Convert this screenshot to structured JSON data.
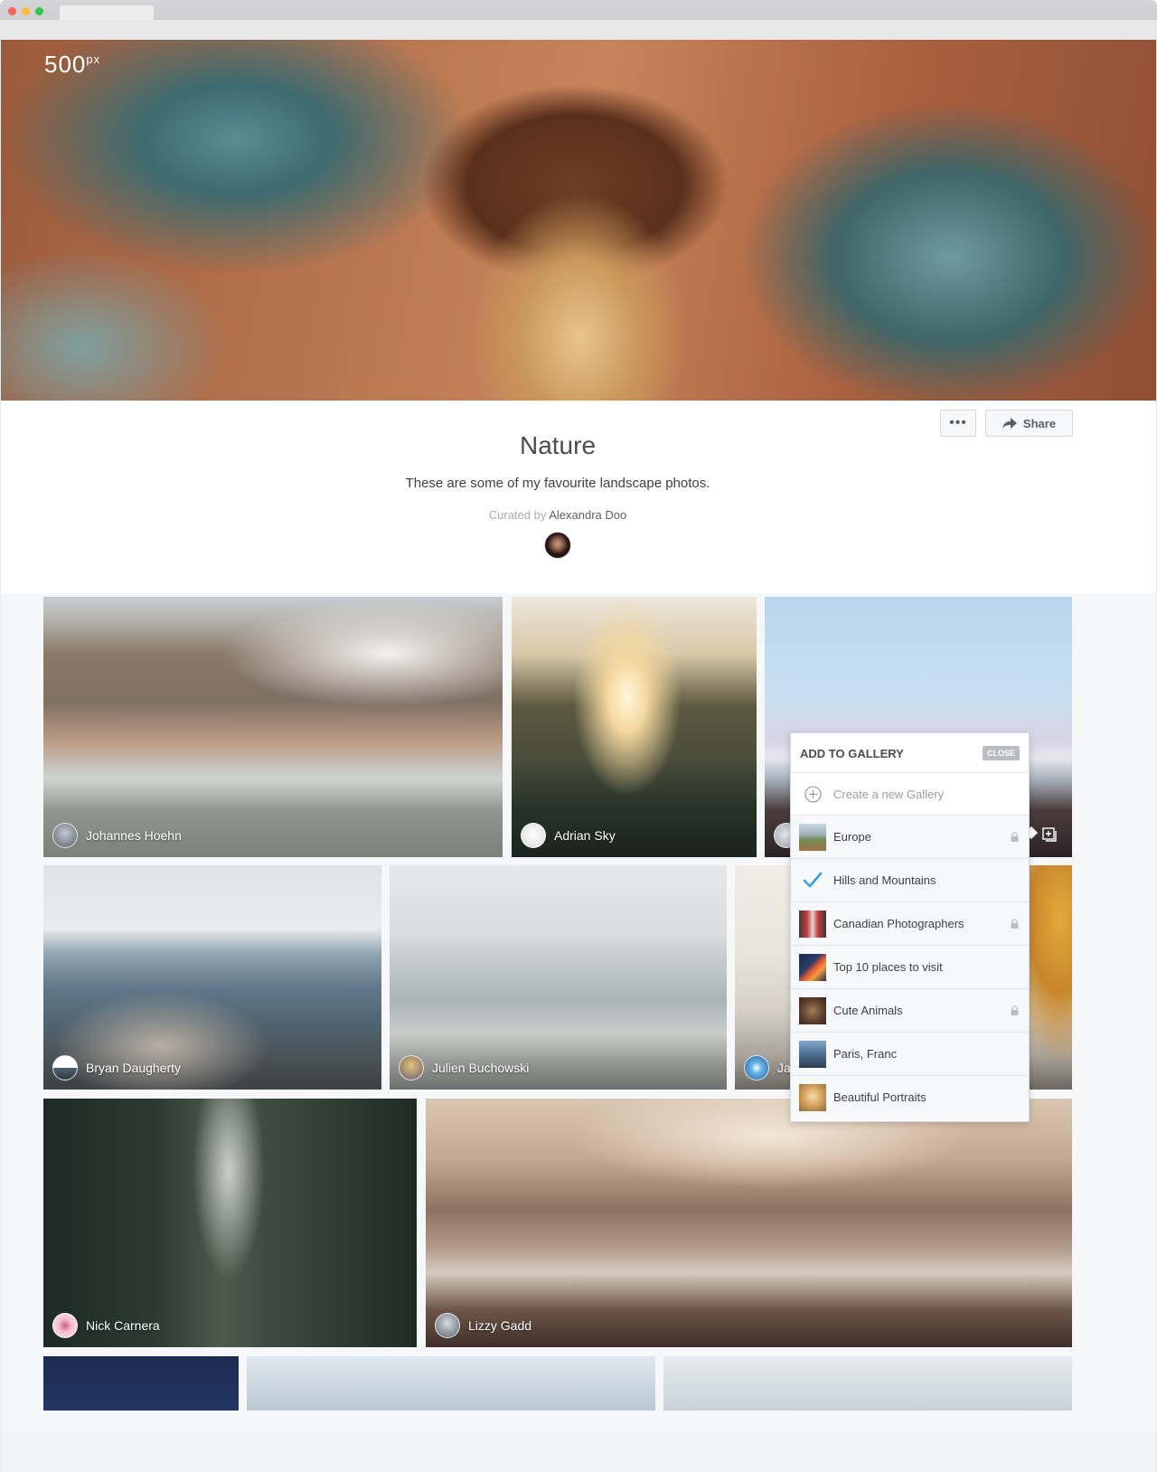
{
  "brand": {
    "logo_text": "500",
    "logo_sup": "px"
  },
  "gallery": {
    "title": "Nature",
    "description": "These are some of my favourite landscape photos.",
    "curated_prefix": "Curated by",
    "curator": "Alexandra Doo"
  },
  "actions": {
    "more": "•••",
    "share": "Share"
  },
  "photos": [
    {
      "author": "Johannes Hoehn"
    },
    {
      "author": "Adrian Sky"
    },
    {
      "author": ""
    },
    {
      "author": "Bryan Daugherty"
    },
    {
      "author": "Julien Buchowski"
    },
    {
      "author": "Ja"
    },
    {
      "author": "Nick Carnera"
    },
    {
      "author": "Lizzy Gadd"
    }
  ],
  "add_to_gallery": {
    "title": "ADD TO GALLERY",
    "close": "CLOSE",
    "create_label": "Create a new Gallery",
    "items": [
      {
        "name": "Europe",
        "locked": true,
        "checked": false,
        "thumb": "thumb-europe"
      },
      {
        "name": "Hills and Mountains",
        "locked": false,
        "checked": true,
        "thumb": "check-icon"
      },
      {
        "name": "Canadian Photographers",
        "locked": true,
        "checked": false,
        "thumb": "thumb-canadian"
      },
      {
        "name": "Top 10 places to visit",
        "locked": false,
        "checked": false,
        "thumb": "thumb-top10"
      },
      {
        "name": "Cute Animals",
        "locked": true,
        "checked": false,
        "thumb": "thumb-animals"
      },
      {
        "name": "Paris, Franc",
        "locked": false,
        "checked": false,
        "thumb": "thumb-paris"
      },
      {
        "name": "Beautiful Portraits",
        "locked": false,
        "checked": false,
        "thumb": "thumb-portraits"
      }
    ]
  },
  "colors": {
    "accent_check": "#3aa0e3",
    "text_dark": "#4a4d53",
    "close_badge": "#b9bdc2"
  }
}
